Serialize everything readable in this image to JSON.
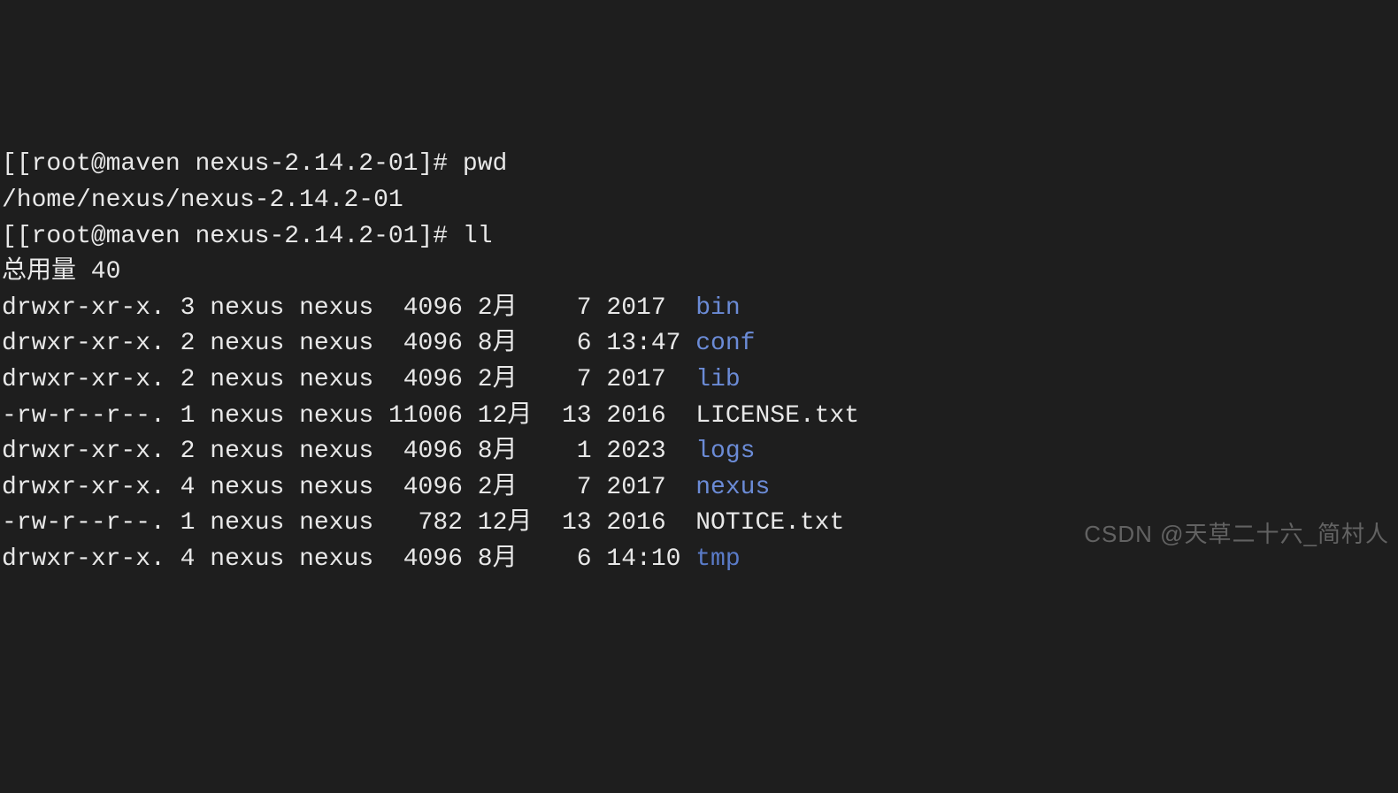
{
  "prompts": [
    {
      "prefix": "[",
      "prompt": "[root@maven nexus-2.14.2-01]# ",
      "command": "pwd"
    },
    {
      "prefix": "[",
      "prompt": "[root@maven nexus-2.14.2-01]# ",
      "command": "ll"
    }
  ],
  "pwd_output": "/home/nexus/nexus-2.14.2-01",
  "total_line": "总用量 40",
  "files": [
    {
      "perms": "drwxr-xr-x.",
      "links": "3",
      "owner": "nexus",
      "group": "nexus",
      "size": "4096",
      "month": "2月",
      "day": "7",
      "timeyear": "2017",
      "name": "bin",
      "is_dir": true
    },
    {
      "perms": "drwxr-xr-x.",
      "links": "2",
      "owner": "nexus",
      "group": "nexus",
      "size": "4096",
      "month": "8月",
      "day": "6",
      "timeyear": "13:47",
      "name": "conf",
      "is_dir": true
    },
    {
      "perms": "drwxr-xr-x.",
      "links": "2",
      "owner": "nexus",
      "group": "nexus",
      "size": "4096",
      "month": "2月",
      "day": "7",
      "timeyear": "2017",
      "name": "lib",
      "is_dir": true
    },
    {
      "perms": "-rw-r--r--.",
      "links": "1",
      "owner": "nexus",
      "group": "nexus",
      "size": "11006",
      "month": "12月",
      "day": "13",
      "timeyear": "2016",
      "name": "LICENSE.txt",
      "is_dir": false
    },
    {
      "perms": "drwxr-xr-x.",
      "links": "2",
      "owner": "nexus",
      "group": "nexus",
      "size": "4096",
      "month": "8月",
      "day": "1",
      "timeyear": "2023",
      "name": "logs",
      "is_dir": true
    },
    {
      "perms": "drwxr-xr-x.",
      "links": "4",
      "owner": "nexus",
      "group": "nexus",
      "size": "4096",
      "month": "2月",
      "day": "7",
      "timeyear": "2017",
      "name": "nexus",
      "is_dir": true
    },
    {
      "perms": "-rw-r--r--.",
      "links": "1",
      "owner": "nexus",
      "group": "nexus",
      "size": "782",
      "month": "12月",
      "day": "13",
      "timeyear": "2016",
      "name": "NOTICE.txt",
      "is_dir": false
    },
    {
      "perms": "drwxr-xr-x.",
      "links": "4",
      "owner": "nexus",
      "group": "nexus",
      "size": "4096",
      "month": "8月",
      "day": "6",
      "timeyear": "14:10",
      "name": "tmp",
      "is_dir": true,
      "dim": true
    }
  ],
  "watermark": "CSDN @天草二十六_简村人"
}
